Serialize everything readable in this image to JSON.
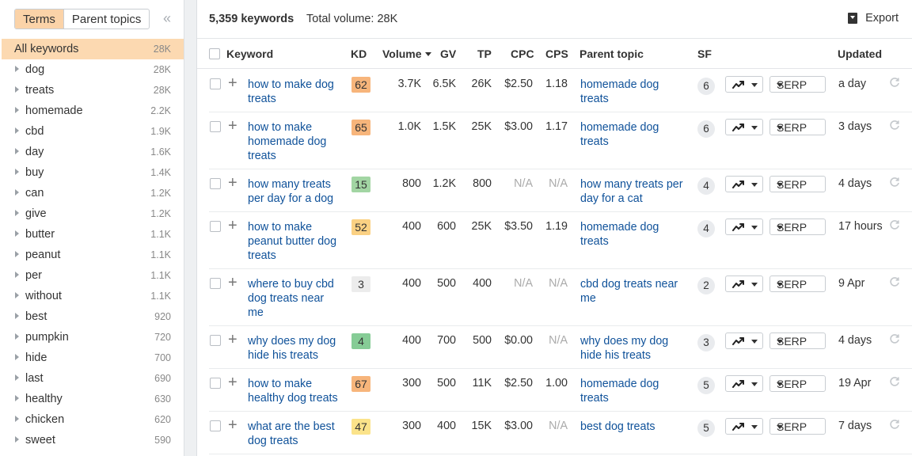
{
  "sidebar": {
    "toggle": {
      "terms": "Terms",
      "parent_topics": "Parent topics"
    },
    "collapse_icon": "double-chevron-left",
    "terms": [
      {
        "label": "All keywords",
        "count": "28K",
        "selected": true
      },
      {
        "label": "dog",
        "count": "28K"
      },
      {
        "label": "treats",
        "count": "28K"
      },
      {
        "label": "homemade",
        "count": "2.2K"
      },
      {
        "label": "cbd",
        "count": "1.9K"
      },
      {
        "label": "day",
        "count": "1.6K"
      },
      {
        "label": "buy",
        "count": "1.4K"
      },
      {
        "label": "can",
        "count": "1.2K"
      },
      {
        "label": "give",
        "count": "1.2K"
      },
      {
        "label": "butter",
        "count": "1.1K"
      },
      {
        "label": "peanut",
        "count": "1.1K"
      },
      {
        "label": "per",
        "count": "1.1K"
      },
      {
        "label": "without",
        "count": "1.1K"
      },
      {
        "label": "best",
        "count": "920"
      },
      {
        "label": "pumpkin",
        "count": "720"
      },
      {
        "label": "hide",
        "count": "700"
      },
      {
        "label": "last",
        "count": "690"
      },
      {
        "label": "healthy",
        "count": "630"
      },
      {
        "label": "chicken",
        "count": "620"
      },
      {
        "label": "sweet",
        "count": "590"
      }
    ]
  },
  "header": {
    "keyword_count": "5,359 keywords",
    "total_volume": "Total volume: 28K",
    "export_label": "Export"
  },
  "columns": {
    "keyword": "Keyword",
    "kd": "KD",
    "volume": "Volume",
    "gv": "GV",
    "tp": "TP",
    "cpc": "CPC",
    "cps": "CPS",
    "parent_topic": "Parent topic",
    "sf": "SF",
    "updated": "Updated"
  },
  "colors": {
    "accent": "#fcd9b1",
    "link": "#10529a",
    "kd_orange": "#f7b57b",
    "kd_green": "#a2d5a3",
    "kd_darkgreen": "#86cc96",
    "kd_yellow": "#fbe38a",
    "kd_gray": "#ececec"
  },
  "rows": [
    {
      "keyword": "how to make dog treats",
      "kd": "62",
      "kd_color": "#f7b57b",
      "volume": "3.7K",
      "gv": "6.5K",
      "tp": "26K",
      "cpc": "$2.50",
      "cps": "1.18",
      "parent_topic": "homemade dog treats",
      "sf": "6",
      "serp": "SERP",
      "updated": "a day"
    },
    {
      "keyword": "how to make homemade dog treats",
      "kd": "65",
      "kd_color": "#f7b57b",
      "volume": "1.0K",
      "gv": "1.5K",
      "tp": "25K",
      "cpc": "$3.00",
      "cps": "1.17",
      "parent_topic": "homemade dog treats",
      "sf": "6",
      "serp": "SERP",
      "updated": "3 days"
    },
    {
      "keyword": "how many treats per day for a dog",
      "kd": "15",
      "kd_color": "#a2d5a3",
      "volume": "800",
      "gv": "1.2K",
      "tp": "800",
      "cpc": "N/A",
      "cps": "N/A",
      "parent_topic": "how many treats per day for a cat",
      "sf": "4",
      "serp": "SERP",
      "updated": "4 days"
    },
    {
      "keyword": "how to make peanut butter dog treats",
      "kd": "52",
      "kd_color": "#fbd183",
      "volume": "400",
      "gv": "600",
      "tp": "25K",
      "cpc": "$3.50",
      "cps": "1.19",
      "parent_topic": "homemade dog treats",
      "sf": "4",
      "serp": "SERP",
      "updated": "17 hours"
    },
    {
      "keyword": "where to buy cbd dog treats near me",
      "kd": "3",
      "kd_color": "#ececec",
      "volume": "400",
      "gv": "500",
      "tp": "400",
      "cpc": "N/A",
      "cps": "N/A",
      "parent_topic": "cbd dog treats near me",
      "sf": "2",
      "serp": "SERP",
      "updated": "9 Apr"
    },
    {
      "keyword": "why does my dog hide his treats",
      "kd": "4",
      "kd_color": "#86cc96",
      "volume": "400",
      "gv": "700",
      "tp": "500",
      "cpc": "$0.00",
      "cps": "N/A",
      "parent_topic": "why does my dog hide his treats",
      "sf": "3",
      "serp": "SERP",
      "updated": "4 days"
    },
    {
      "keyword": "how to make healthy dog treats",
      "kd": "67",
      "kd_color": "#f7b57b",
      "volume": "300",
      "gv": "500",
      "tp": "11K",
      "cpc": "$2.50",
      "cps": "1.00",
      "parent_topic": "homemade dog treats",
      "sf": "5",
      "serp": "SERP",
      "updated": "19 Apr"
    },
    {
      "keyword": "what are the best dog treats",
      "kd": "47",
      "kd_color": "#fbe38a",
      "volume": "300",
      "gv": "400",
      "tp": "15K",
      "cpc": "$3.00",
      "cps": "N/A",
      "parent_topic": "best dog treats",
      "sf": "5",
      "serp": "SERP",
      "updated": "7 days"
    }
  ]
}
